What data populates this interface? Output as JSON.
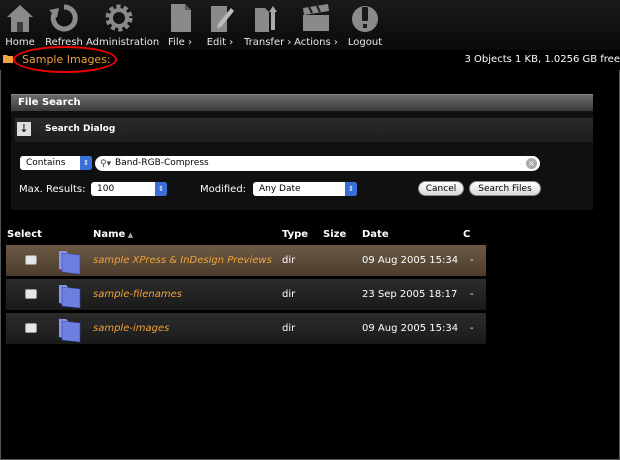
{
  "toolbar": {
    "items": [
      {
        "label": "Home",
        "icon": "home-icon"
      },
      {
        "label": "Refresh",
        "icon": "refresh-icon"
      },
      {
        "label": "Administration",
        "icon": "gear-icon"
      },
      {
        "label": "File",
        "icon": "file-icon"
      },
      {
        "label": "Edit",
        "icon": "edit-icon"
      },
      {
        "label": "Transfer",
        "icon": "transfer-icon"
      },
      {
        "label": "Actions",
        "icon": "clapper-icon"
      },
      {
        "label": "Logout",
        "icon": "power-icon"
      }
    ],
    "menu_arrow": "›"
  },
  "location": {
    "path": "Sample Images:",
    "status": "3 Objects 1 KB, 1.0256 GB free"
  },
  "file_search": {
    "panel_title": "File Search",
    "dialog_title": "Search Dialog",
    "match_mode": "Contains",
    "query": "Band-RGB-Compress",
    "max_results_label": "Max. Results:",
    "max_results_value": "100",
    "modified_label": "Modified:",
    "modified_value": "Any Date",
    "cancel_label": "Cancel",
    "search_label": "Search Files"
  },
  "table": {
    "headers": {
      "select": "Select",
      "name": "Name",
      "type": "Type",
      "size": "Size",
      "date": "Date",
      "c": "C"
    },
    "rows": [
      {
        "name": "sample XPress & InDesign Previews",
        "type": "dir",
        "date": "09 Aug 2005 15:34",
        "c": "-"
      },
      {
        "name": "sample-filenames",
        "type": "dir",
        "date": "23 Sep 2005 18:17",
        "c": "-"
      },
      {
        "name": "sample-images",
        "type": "dir",
        "date": "09 Aug 2005 15:34",
        "c": "-"
      }
    ]
  },
  "colors": {
    "accent": "#f0a23a",
    "highlight_ring": "#e00000",
    "select_blue": "#3a6fd8"
  }
}
